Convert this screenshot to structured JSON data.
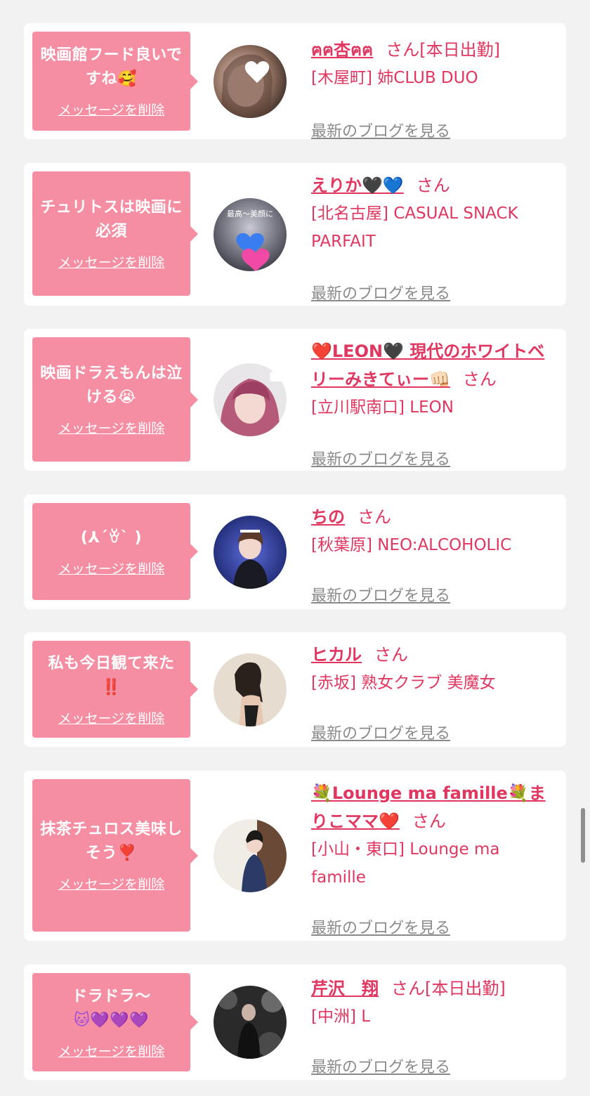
{
  "common": {
    "delete_label": "メッセージを削除",
    "san": "さん",
    "blog_label": "最新のブログを見る"
  },
  "items": [
    {
      "message": "映画館フード良いですね",
      "message_emoji": "🥰",
      "name": "ฅฅ杏ฅฅ",
      "status": "[本日出勤]",
      "shop": "[木屋町] 姉CLUB DUO"
    },
    {
      "message": "チュリトスは映画に必須",
      "name": "えりか",
      "name_emoji": [
        "🖤",
        "💙"
      ],
      "shop": "[北名古屋] CASUAL SNACK PARFAIT"
    },
    {
      "message": "映画ドラえもんは泣ける",
      "message_emoji": "😭",
      "name": "❤️LEON🖤 現代のホワイトベリーみきてぃー",
      "name_emoji": [
        "👊🏻"
      ],
      "shop": "[立川駅南口] LEON"
    },
    {
      "message": "(⅄´ꈊ` )",
      "name": "ちの",
      "shop": "[秋葉原] NEO:ALCOHOLIC"
    },
    {
      "message": "私も今日観て来た",
      "message_emoji": "‼️",
      "name": "ヒカル",
      "shop": "[赤坂] 熟女クラブ 美魔女"
    },
    {
      "message": "抹茶チュロス美味しそう",
      "message_emoji": "❣️",
      "name": "💐Lounge ma famille💐まりこママ",
      "name_emoji": [
        "❤️"
      ],
      "shop": "[小山・東口] Lounge ma famille"
    },
    {
      "message": "ドラドラ〜",
      "message_emoji": "🐱💜💜💜",
      "name": "芹沢　翔",
      "status": "[本日出勤]",
      "shop": "[中洲] L"
    }
  ],
  "colors": {
    "accent": "#e0365f",
    "bubble": "#f58ea3",
    "background": "#f2f2f2"
  }
}
